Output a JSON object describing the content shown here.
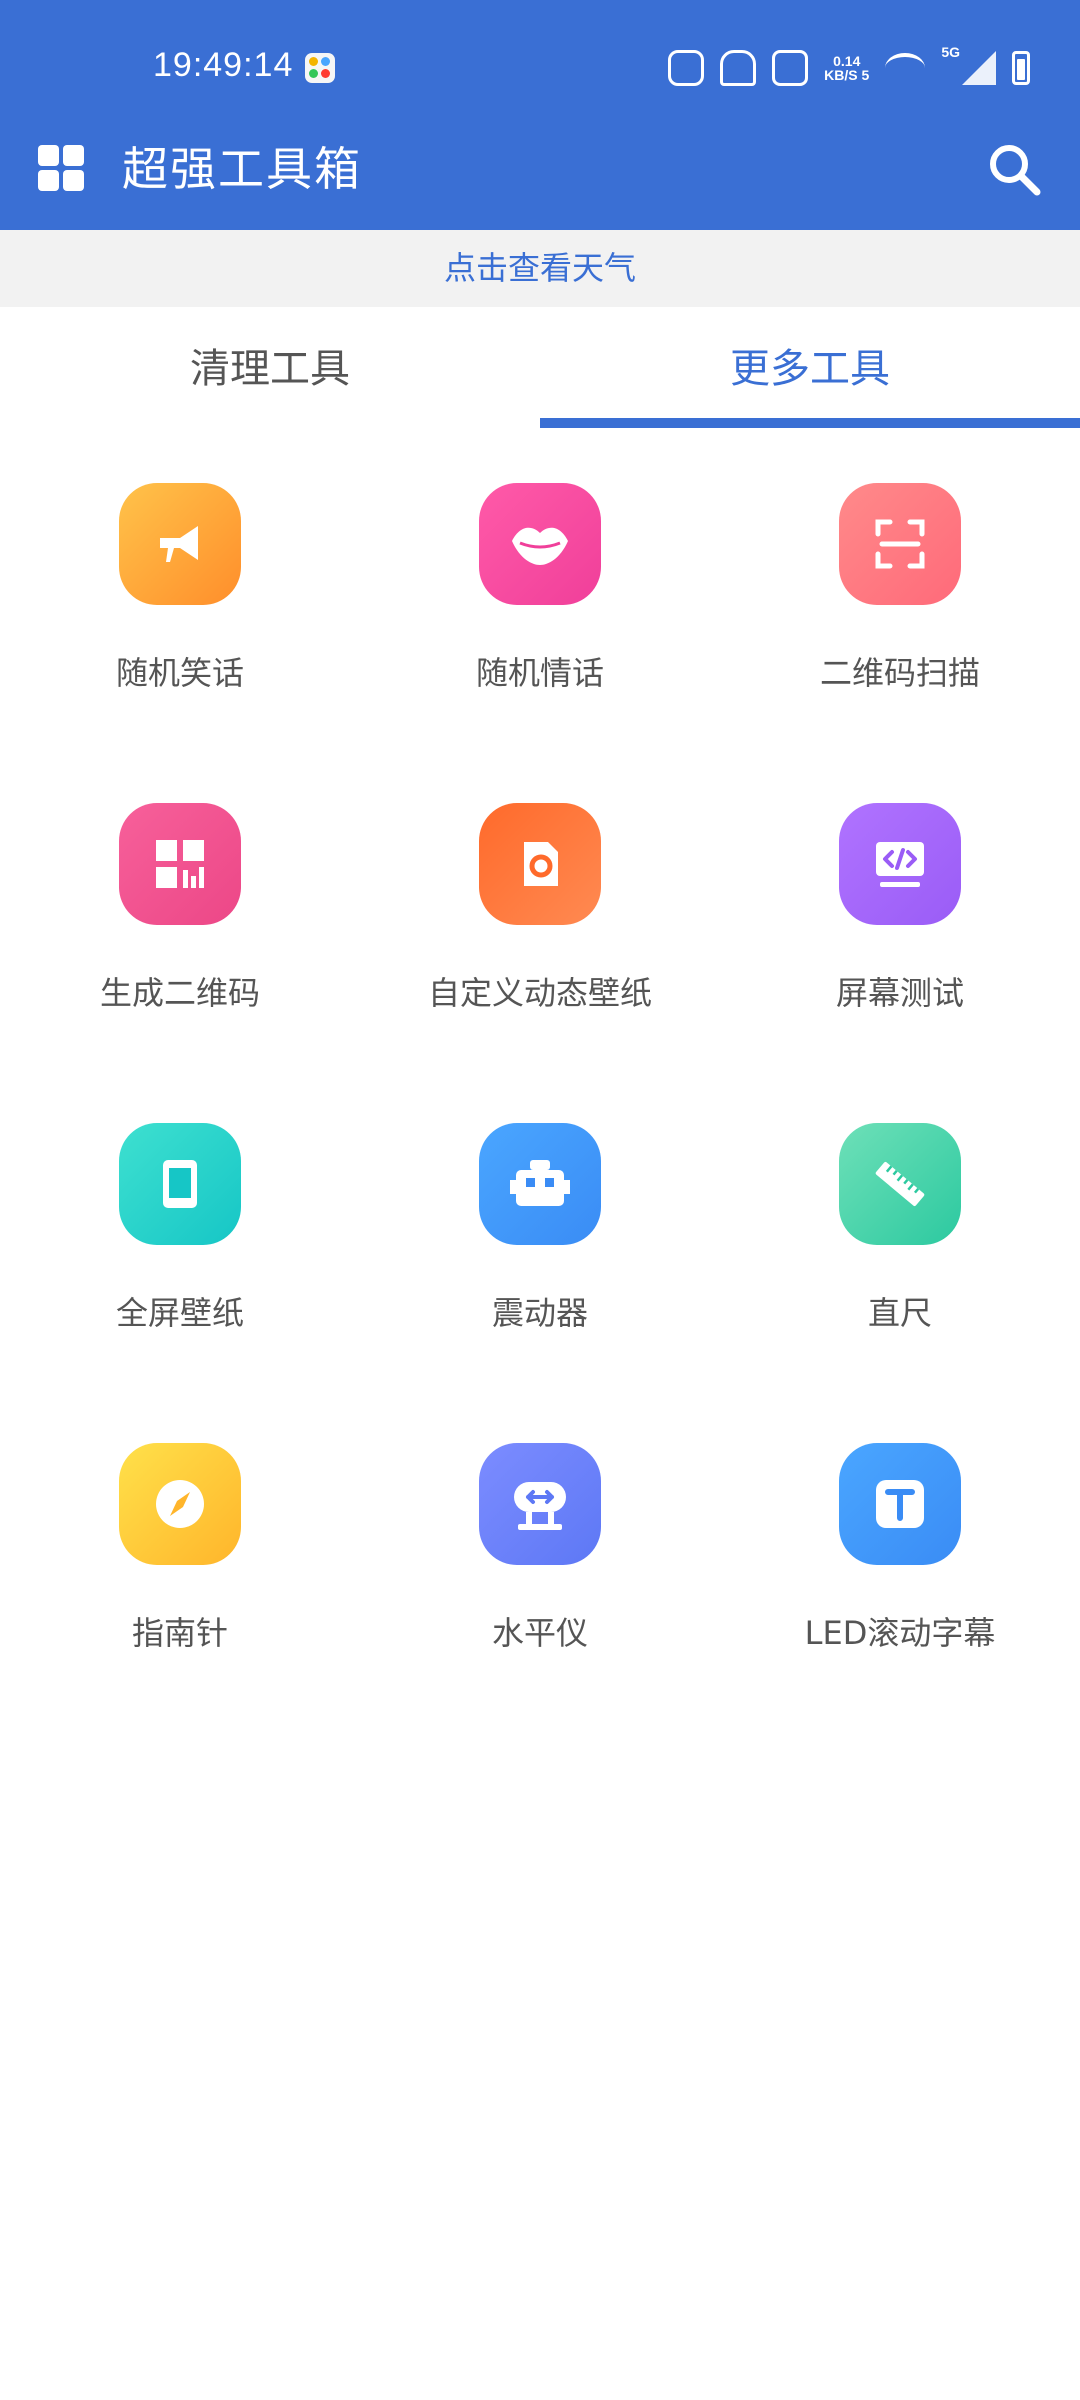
{
  "status_bar": {
    "time": "19:49:14",
    "net_speed_value": "0.14",
    "net_speed_unit": "KB/S",
    "net_speed_extra": "5",
    "network_type": "5G"
  },
  "app_bar": {
    "title": "超强工具箱",
    "menu_icon": "grid-icon",
    "search_icon": "search-icon"
  },
  "weather_banner": "点击查看天气",
  "tabs": [
    {
      "label": "清理工具",
      "active": false
    },
    {
      "label": "更多工具",
      "active": true
    }
  ],
  "accent_color": "#3a6fd4",
  "tools": [
    {
      "label": "随机笑话",
      "icon": "megaphone-icon",
      "colors": [
        "#ffc34a",
        "#ff8e2b"
      ]
    },
    {
      "label": "随机情话",
      "icon": "lips-icon",
      "colors": [
        "#ff5aa8",
        "#f03f9a"
      ]
    },
    {
      "label": "二维码扫描",
      "icon": "scan-frame-icon",
      "colors": [
        "#ff8a8a",
        "#ff6a7a"
      ]
    },
    {
      "label": "生成二维码",
      "icon": "qr-grid-icon",
      "colors": [
        "#f7609a",
        "#ec4787"
      ]
    },
    {
      "label": "自定义动态壁纸",
      "icon": "wallpaper-ring-icon",
      "colors": [
        "#ff6a2b",
        "#ff8a52"
      ]
    },
    {
      "label": "屏幕测试",
      "icon": "code-screen-icon",
      "colors": [
        "#b073ff",
        "#9a5cf6"
      ]
    },
    {
      "label": "全屏壁纸",
      "icon": "phone-frame-icon",
      "colors": [
        "#3ee0d0",
        "#16c6c6"
      ]
    },
    {
      "label": "震动器",
      "icon": "robot-icon",
      "colors": [
        "#4aa6ff",
        "#3a8cf5"
      ]
    },
    {
      "label": "直尺",
      "icon": "ruler-icon",
      "colors": [
        "#6ee0b8",
        "#2cc9a0"
      ]
    },
    {
      "label": "指南针",
      "icon": "compass-icon",
      "colors": [
        "#ffe14a",
        "#ffb52b"
      ]
    },
    {
      "label": "水平仪",
      "icon": "level-icon",
      "colors": [
        "#7c8cff",
        "#5d78f5"
      ]
    },
    {
      "label": "LED滚动字幕",
      "icon": "text-t-icon",
      "colors": [
        "#4aa6ff",
        "#3a8cf5"
      ]
    }
  ]
}
